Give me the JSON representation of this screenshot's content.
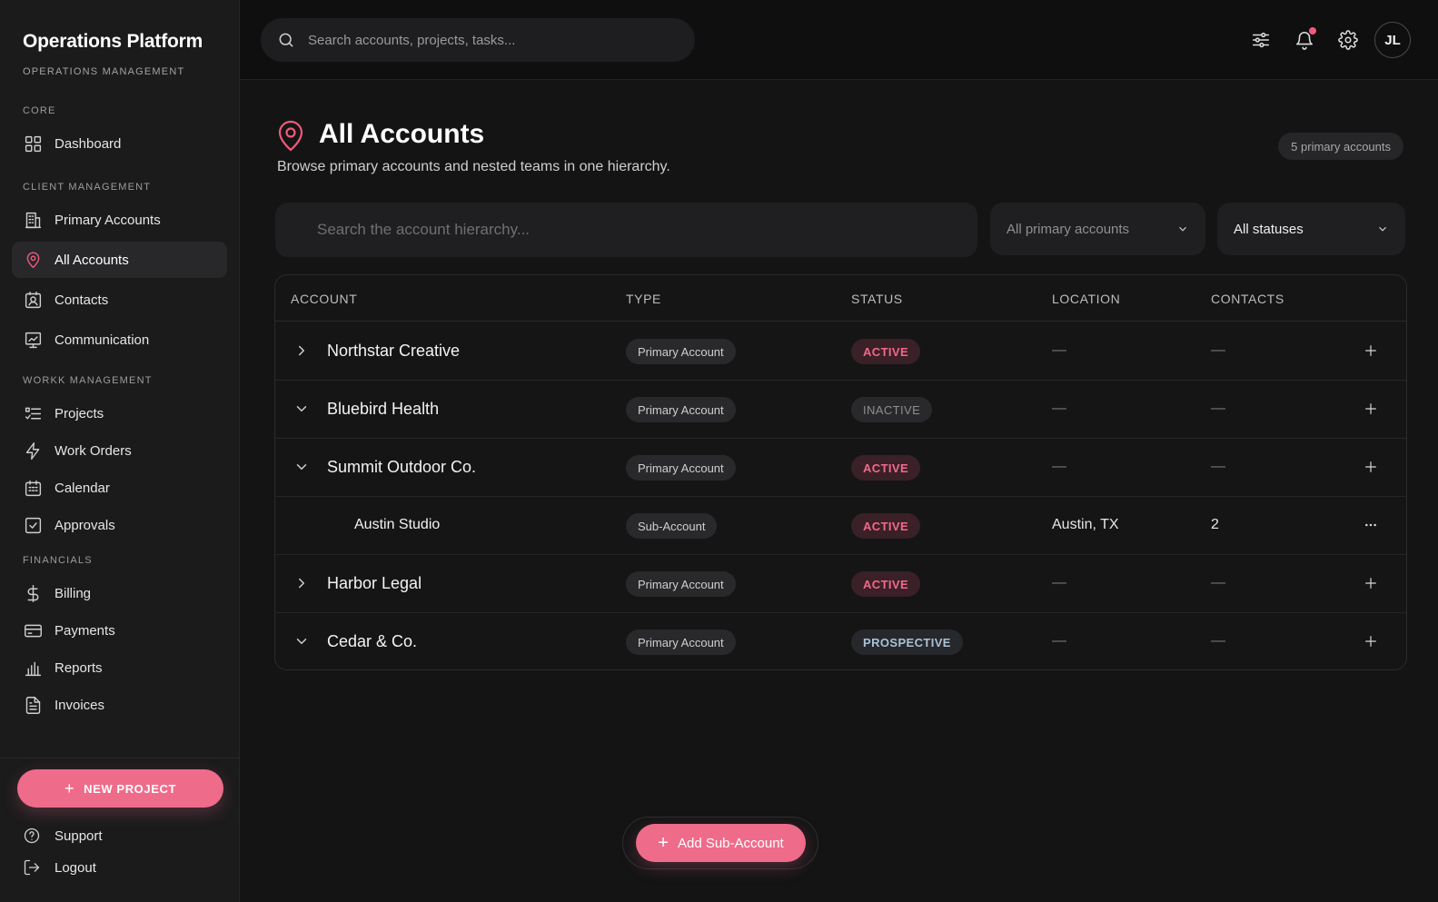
{
  "app": {
    "title": "Operations Platform",
    "subtitle": "OPERATIONS MANAGEMENT"
  },
  "sidebar": {
    "sections": [
      "CORE",
      "CLIENT MANAGEMENT",
      "WORKK MANAGEMENT",
      "FINANCIALS"
    ],
    "items": [
      {
        "label": "Dashboard",
        "icon": "grid-icon"
      },
      {
        "label": "Primary Accounts",
        "icon": "building-icon"
      },
      {
        "label": "All Accounts",
        "icon": "map-pin-icon",
        "active": true
      },
      {
        "label": "Contacts",
        "icon": "contact-card-icon"
      },
      {
        "label": "Communication",
        "icon": "presentation-icon"
      },
      {
        "label": "Projects",
        "icon": "list-check-icon"
      },
      {
        "label": "Work Orders",
        "icon": "lightning-icon"
      },
      {
        "label": "Calendar",
        "icon": "calendar-icon"
      },
      {
        "label": "Approvals",
        "icon": "checkbox-icon"
      },
      {
        "label": "Billing",
        "icon": "dollar-icon"
      },
      {
        "label": "Payments",
        "icon": "credit-card-icon"
      },
      {
        "label": "Reports",
        "icon": "bar-chart-icon"
      },
      {
        "label": "Invoices",
        "icon": "document-icon"
      }
    ],
    "new_project": "NEW PROJECT",
    "support": "Support",
    "logout": "Logout"
  },
  "topbar": {
    "search_placeholder": "Search accounts, projects, tasks...",
    "avatar_initials": "JL"
  },
  "page": {
    "title": "All Accounts",
    "subtitle": "Browse primary accounts and nested teams in one hierarchy.",
    "count_badge": "5 primary accounts",
    "filter_placeholder": "Search the account hierarchy...",
    "primary_filter": "All primary accounts",
    "status_filter": "All statuses"
  },
  "table": {
    "headers": [
      "ACCOUNT",
      "TYPE",
      "STATUS",
      "LOCATION",
      "CONTACTS"
    ],
    "rows": [
      {
        "name": "Northstar Creative",
        "type": "Primary Account",
        "status": "ACTIVE",
        "location": "—",
        "contacts": "—"
      },
      {
        "name": "Bluebird Health",
        "type": "Primary Account",
        "status": "INACTIVE",
        "location": "—",
        "contacts": "—"
      },
      {
        "name": "Summit Outdoor Co.",
        "type": "Primary Account",
        "status": "ACTIVE",
        "location": "—",
        "contacts": "—"
      },
      {
        "name": "Austin Studio",
        "type": "Sub-Account",
        "status": "ACTIVE",
        "location": "Austin, TX",
        "contacts": "2"
      },
      {
        "name": "Harbor Legal",
        "type": "Primary Account",
        "status": "ACTIVE",
        "location": "—",
        "contacts": "—"
      },
      {
        "name": "Cedar & Co.",
        "type": "Primary Account",
        "status": "PROSPECTIVE",
        "location": "—",
        "contacts": "—"
      }
    ]
  },
  "floating": {
    "add_sub_account": "Add Sub-Account"
  },
  "colors": {
    "accent": "#ef6b8a",
    "background": "#141414",
    "sidebar": "#1b1b1c"
  }
}
